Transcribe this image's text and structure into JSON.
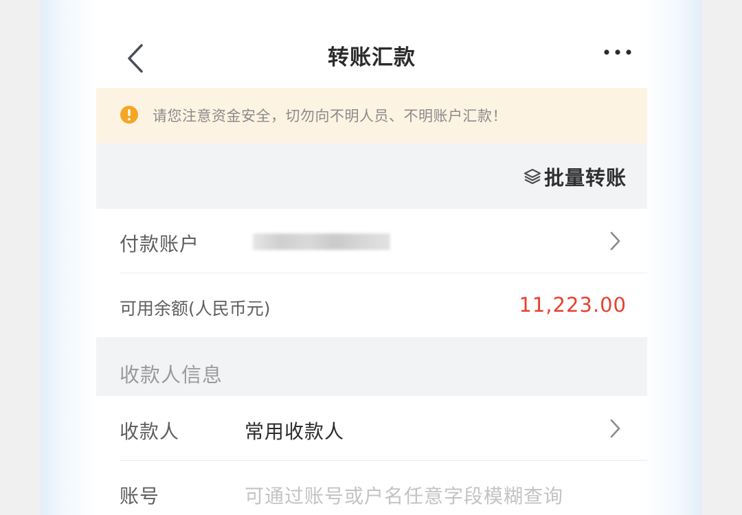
{
  "nav": {
    "title": "转账汇款",
    "back_icon": "chevron-left-icon",
    "more_icon": "more-dots-icon"
  },
  "warning": {
    "icon": "exclamation-circle-icon",
    "text": "请您注意资金安全，切勿向不明人员、不明账户汇款！",
    "icon_color": "#f5a623"
  },
  "batch": {
    "icon": "layers-icon",
    "label": "批量转账"
  },
  "payer": {
    "label": "付款账户"
  },
  "balance": {
    "label": "可用余额(人民币元)",
    "value": "11,223.00",
    "value_color": "#e8402e"
  },
  "payee_section": {
    "title": "收款人信息"
  },
  "payee": {
    "label": "收款人",
    "value": "常用收款人"
  },
  "account": {
    "label": "账号",
    "placeholder": "可通过账号或户名任意字段模糊查询"
  }
}
